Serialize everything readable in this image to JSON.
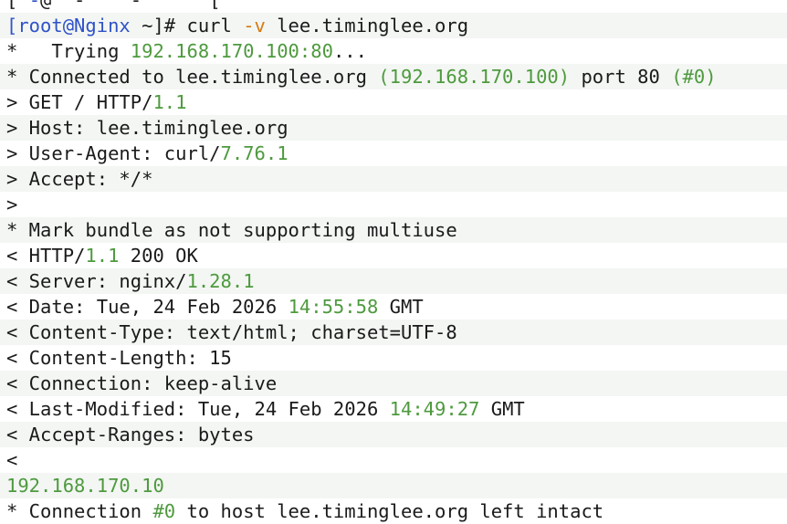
{
  "colors": {
    "background": "#ffffff",
    "text": "#1a1a1a",
    "number": "#4e9a3e",
    "prompt": "#2f52c8",
    "option": "#d77a10",
    "band": "#f3f6f3"
  },
  "terminal": {
    "lines": [
      [
        [
          "text",
          "[ "
        ],
        [
          "prompt",
          "-"
        ],
        [
          "text",
          "@ "
        ],
        [
          "text",
          " - "
        ],
        [
          "text",
          "  "
        ],
        [
          "text",
          " - "
        ],
        [
          "text",
          "   "
        ],
        [
          "text",
          "  "
        ],
        [
          "text",
          "[ "
        ]
      ],
      [
        [
          "prompt",
          "[root@Nginx"
        ],
        [
          "text",
          " ~]# curl "
        ],
        [
          "opt",
          "-v"
        ],
        [
          "text",
          " lee.timinglee.org"
        ]
      ],
      [
        [
          "text",
          "*   Trying "
        ],
        [
          "num",
          "192.168.170.100:80"
        ],
        [
          "text",
          "..."
        ]
      ],
      [
        [
          "text",
          "* Connected to lee.timinglee.org "
        ],
        [
          "num",
          "(192.168.170.100)"
        ],
        [
          "text",
          " port 80 "
        ],
        [
          "num",
          "(#0)"
        ]
      ],
      [
        [
          "text",
          "> GET / HTTP/"
        ],
        [
          "num",
          "1.1"
        ]
      ],
      [
        [
          "text",
          "> Host: lee.timinglee.org"
        ]
      ],
      [
        [
          "text",
          "> User-Agent: curl/"
        ],
        [
          "num",
          "7.76.1"
        ]
      ],
      [
        [
          "text",
          "> Accept: */*"
        ]
      ],
      [
        [
          "text",
          ">"
        ]
      ],
      [
        [
          "text",
          "* Mark bundle as not supporting multiuse"
        ]
      ],
      [
        [
          "text",
          "< HTTP/"
        ],
        [
          "num",
          "1.1"
        ],
        [
          "text",
          " 200 OK"
        ]
      ],
      [
        [
          "text",
          "< Server: nginx/"
        ],
        [
          "num",
          "1.28.1"
        ]
      ],
      [
        [
          "text",
          "< Date: Tue, 24 Feb 2026 "
        ],
        [
          "num",
          "14:55:58"
        ],
        [
          "text",
          " GMT"
        ]
      ],
      [
        [
          "text",
          "< Content-Type: text/html; charset=UTF-8"
        ]
      ],
      [
        [
          "text",
          "< Content-Length: 15"
        ]
      ],
      [
        [
          "text",
          "< Connection: keep-alive"
        ]
      ],
      [
        [
          "text",
          "< Last-Modified: Tue, 24 Feb 2026 "
        ],
        [
          "num",
          "14:49:27"
        ],
        [
          "text",
          " GMT"
        ]
      ],
      [
        [
          "text",
          "< Accept-Ranges: bytes"
        ]
      ],
      [
        [
          "text",
          "<"
        ]
      ],
      [
        [
          "num",
          "192.168.170.10"
        ]
      ],
      [
        [
          "text",
          "* Connection "
        ],
        [
          "num",
          "#0"
        ],
        [
          "text",
          " to host lee.timinglee.org left intact"
        ]
      ]
    ]
  }
}
